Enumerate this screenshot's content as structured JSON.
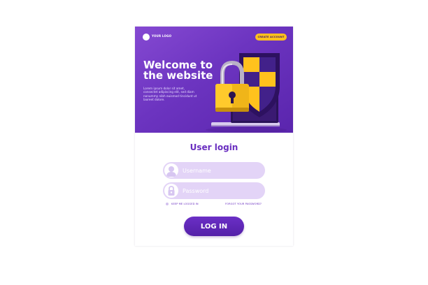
{
  "header": {
    "logo_text": "YOUR LOGO",
    "create_account_label": "CREATE ACCOUNT"
  },
  "hero": {
    "title_line1": "Welcome to",
    "title_line2": "the website",
    "description": "Lorem ipsum dolor sit amet, consectet adipiscing elit, sed diam nonummy nibh euismod tincidunt ut laoreet dolore."
  },
  "login": {
    "title": "User login",
    "username_placeholder": "Username",
    "password_placeholder": "Password",
    "remember_label": "KEEP ME LOGGED IN",
    "forgot_label": "FORGOT YOUR PASSWORD?",
    "button_label": "LOG IN"
  },
  "colors": {
    "primary_purple": "#6a2fc0",
    "accent_yellow": "#ffc21d",
    "field_bg": "#e3d4f7"
  },
  "icons": {
    "username": "user-icon",
    "password": "lock-icon",
    "hero_art": "padlock-shield-laptop-illustration"
  }
}
